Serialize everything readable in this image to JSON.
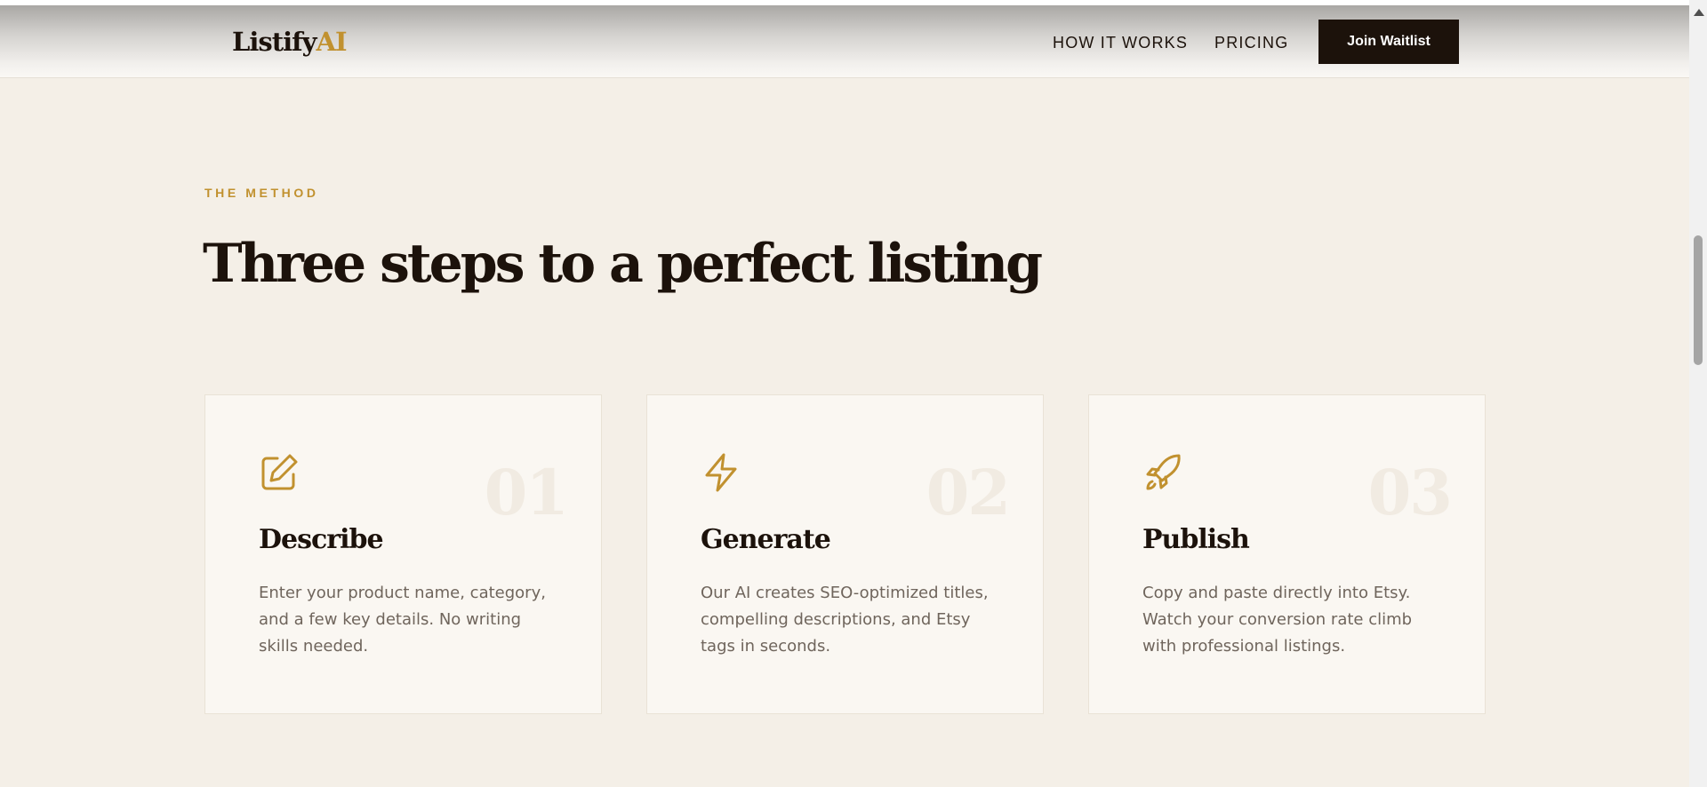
{
  "nav": {
    "logo_main": "Listify",
    "logo_accent": "AI",
    "links": [
      "HOW IT WORKS",
      "PRICING"
    ],
    "cta_label": "Join Waitlist"
  },
  "section": {
    "eyebrow": "THE METHOD",
    "title": "Three steps to a perfect listing"
  },
  "steps": [
    {
      "number": "01",
      "icon": "edit-icon",
      "title": "Describe",
      "description": "Enter your product name, category, and a few key details. No writing skills needed."
    },
    {
      "number": "02",
      "icon": "lightning-icon",
      "title": "Generate",
      "description": "Our AI creates SEO-optimized titles, compelling descriptions, and Etsy tags in seconds."
    },
    {
      "number": "03",
      "icon": "rocket-icon",
      "title": "Publish",
      "description": "Copy and paste directly into Etsy. Watch your conversion rate climb with professional listings."
    }
  ],
  "colors": {
    "accent": "#c1912f",
    "dark": "#1c120b",
    "background": "#f4efe7",
    "card": "#faf7f2"
  }
}
